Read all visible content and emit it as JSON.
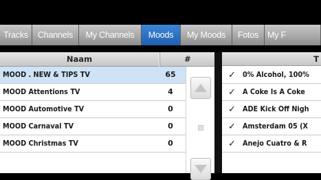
{
  "tabs": [
    {
      "label": "Tracks",
      "active": false
    },
    {
      "label": "Channels",
      "active": false
    },
    {
      "label": "My Channels",
      "active": false
    },
    {
      "label": "Moods",
      "active": true
    },
    {
      "label": "My Moods",
      "active": false
    },
    {
      "label": "Fotos",
      "active": false
    },
    {
      "label": "My F",
      "active": false
    }
  ],
  "left_table": {
    "headers": {
      "name": "Naam",
      "count": "#"
    },
    "rows": [
      {
        "name": "MOOD . NEW & TIPS TV",
        "count": "65",
        "selected": true
      },
      {
        "name": "MOOD Attentions TV",
        "count": "4",
        "selected": false
      },
      {
        "name": "MOOD Automotive TV",
        "count": "0",
        "selected": false
      },
      {
        "name": "MOOD Carnaval TV",
        "count": "0",
        "selected": false
      },
      {
        "name": "MOOD Christmas TV",
        "count": "0",
        "selected": false
      }
    ]
  },
  "right_table": {
    "header": "T",
    "rows": [
      {
        "check": "✓",
        "title": "0% Alcohol, 100%"
      },
      {
        "check": "✓",
        "title": "A Coke Is A Coke"
      },
      {
        "check": "✓",
        "title": "ADE Kick Off Nigh"
      },
      {
        "check": "✓",
        "title": "Amsterdam 05 (X"
      },
      {
        "check": "✓",
        "title": "Anejo Cuatro & R"
      }
    ]
  },
  "colors": {
    "accent": "#2a6fc2",
    "selected_row": "#cfe3f7"
  }
}
